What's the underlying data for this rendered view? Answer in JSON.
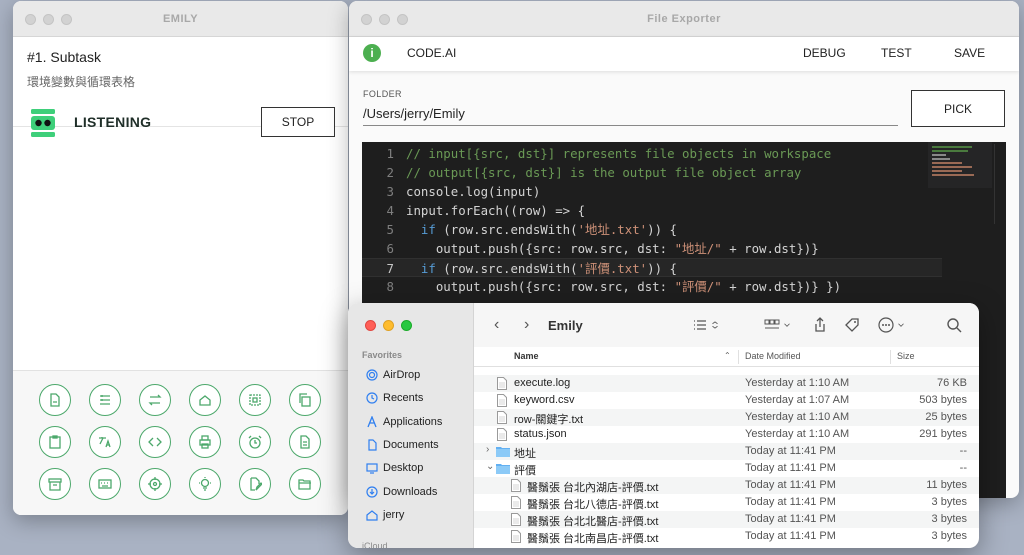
{
  "emily": {
    "title": "EMILY",
    "subtask_title": "#1. Subtask",
    "subtask_desc": "環境變數與循環表格",
    "status": "LISTENING",
    "stop_label": "STOP",
    "accent": "#4ca86b"
  },
  "exporter": {
    "title": "File Exporter",
    "brand": "CODE.AI",
    "menu": {
      "debug": "DEBUG",
      "test": "TEST",
      "save": "SAVE"
    },
    "folder_label": "FOLDER",
    "folder_value": "/Users/jerry/Emily",
    "pick_label": "PICK",
    "code": [
      {
        "n": "1",
        "segs": [
          {
            "t": "// input[{src, dst}] represents file objects in workspace",
            "c": "cm"
          }
        ]
      },
      {
        "n": "2",
        "segs": [
          {
            "t": "// output[{src, dst}] is the output file object array",
            "c": "cm"
          }
        ]
      },
      {
        "n": "3",
        "segs": [
          {
            "t": "console.log(input)",
            "c": "ctext"
          }
        ]
      },
      {
        "n": "4",
        "segs": [
          {
            "t": "input.forEach((row) => {",
            "c": "ctext"
          }
        ]
      },
      {
        "n": "5",
        "segs": [
          {
            "t": "  ",
            "c": "ctext"
          },
          {
            "t": "if",
            "c": "kw"
          },
          {
            "t": " (row.src.endsWith(",
            "c": "ctext"
          },
          {
            "t": "'地址.txt'",
            "c": "str"
          },
          {
            "t": ")) {",
            "c": "ctext"
          }
        ]
      },
      {
        "n": "6",
        "segs": [
          {
            "t": "    output.push({src: row.src, dst: ",
            "c": "ctext"
          },
          {
            "t": "\"地址/\"",
            "c": "str"
          },
          {
            "t": " + row.dst})}",
            "c": "ctext"
          }
        ]
      },
      {
        "n": "7",
        "segs": [
          {
            "t": "  ",
            "c": "ctext"
          },
          {
            "t": "if",
            "c": "kw"
          },
          {
            "t": " (row.src.endsWith(",
            "c": "ctext"
          },
          {
            "t": "'評價.txt'",
            "c": "str"
          },
          {
            "t": ")) {",
            "c": "ctext"
          }
        ]
      },
      {
        "n": "8",
        "segs": [
          {
            "t": "    output.push({src: row.src, dst: ",
            "c": "ctext"
          },
          {
            "t": "\"評價/\"",
            "c": "str"
          },
          {
            "t": " + row.dst})} })",
            "c": "ctext"
          }
        ]
      }
    ]
  },
  "finder": {
    "folder_title": "Emily",
    "favorites_label": "Favorites",
    "sidebar": [
      "AirDrop",
      "Recents",
      "Applications",
      "Documents",
      "Desktop",
      "Downloads",
      "jerry"
    ],
    "sidebar_partial": "iCloud",
    "columns": {
      "name": "Name",
      "date": "Date Modified",
      "size": "Size"
    },
    "rows": [
      {
        "name": "execute.log",
        "date": "Yesterday at 1:10 AM",
        "size": "76 KB",
        "kind": "file"
      },
      {
        "name": "keyword.csv",
        "date": "Yesterday at 1:07 AM",
        "size": "503 bytes",
        "kind": "file"
      },
      {
        "name": "row-關鍵字.txt",
        "date": "Yesterday at 1:10 AM",
        "size": "25 bytes",
        "kind": "file"
      },
      {
        "name": "status.json",
        "date": "Yesterday at 1:10 AM",
        "size": "291 bytes",
        "kind": "file"
      },
      {
        "name": "地址",
        "date": "Today at 11:41 PM",
        "size": "--",
        "kind": "folder-closed"
      },
      {
        "name": "評價",
        "date": "Today at 11:41 PM",
        "size": "--",
        "kind": "folder-open"
      },
      {
        "name": "醫鬚張 台北內湖店-評價.txt",
        "date": "Today at 11:41 PM",
        "size": "11 bytes",
        "kind": "child"
      },
      {
        "name": "醫鬚張 台北八德店-評價.txt",
        "date": "Today at 11:41 PM",
        "size": "3 bytes",
        "kind": "child"
      },
      {
        "name": "醫鬚張 台北北醫店-評價.txt",
        "date": "Today at 11:41 PM",
        "size": "3 bytes",
        "kind": "child"
      },
      {
        "name": "醫鬚張 台北南昌店-評價.txt",
        "date": "Today at 11:41 PM",
        "size": "3 bytes",
        "kind": "child"
      }
    ]
  },
  "tool_icons": [
    "document-icon",
    "list-icon",
    "swap-icon",
    "home-icon",
    "select-all-icon",
    "copy-icon",
    "clipboard-icon",
    "translate-icon",
    "code-icon",
    "print-icon",
    "alarm-icon",
    "file-list-icon",
    "archive-icon",
    "keyboard-icon",
    "target-icon",
    "lightbulb-icon",
    "edit-file-icon",
    "folder-open-icon"
  ]
}
